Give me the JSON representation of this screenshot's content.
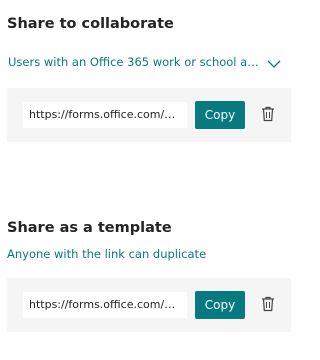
{
  "share_collaborate": {
    "title": "Share to collaborate",
    "audience": {
      "selected": "Users with an Office 365 work or school account...",
      "icon": "chevron-down-icon"
    },
    "link": {
      "value": "https://forms.office.com/Pages/DesignPageV2.aspx",
      "copy_label": "Copy",
      "delete_icon": "trash-icon"
    }
  },
  "share_template": {
    "title": "Share as a template",
    "subtitle": "Anyone with the link can duplicate",
    "link": {
      "value": "https://forms.office.com/Pages/ShareFormPage.aspx",
      "copy_label": "Copy",
      "delete_icon": "trash-icon"
    }
  },
  "colors": {
    "accent": "#077a80",
    "panel_bg": "#f5f5f5",
    "text": "#242424"
  }
}
